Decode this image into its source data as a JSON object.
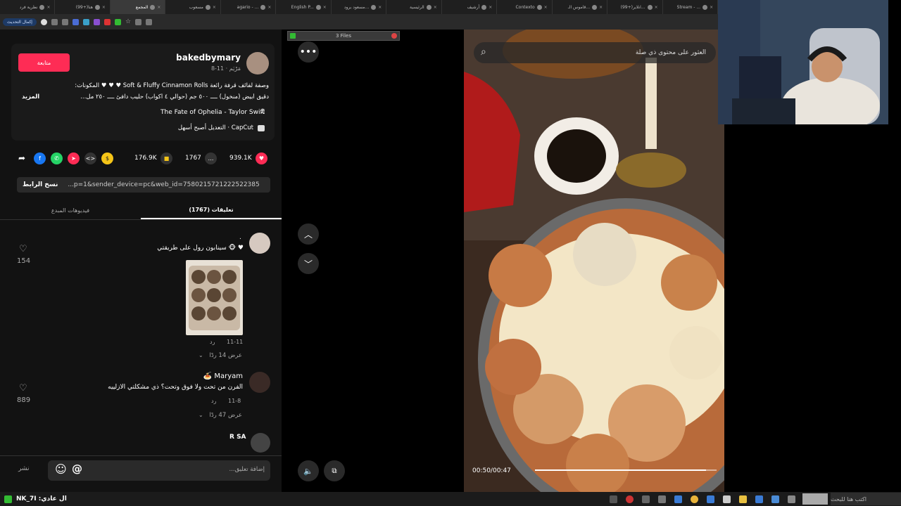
{
  "tabs": [
    "Stream - ...",
    "(99+)انلاير...",
    "قاموس الـ...",
    "Contexto",
    "أرشيف",
    "الرئيسية",
    "مسعود برود...",
    "English P...",
    "agario - ...",
    "مسعوب",
    "المجمع",
    "(99+)هنا",
    "نظرية فرد"
  ],
  "toolbar": {
    "update_label": "إكمال التحديث"
  },
  "download": {
    "label": "3 Files"
  },
  "post": {
    "follow_label": "متابعة",
    "username": "bakedbymary",
    "subtitle": "مَرْيَم · 11-8",
    "desc_line1": "وصفة لفائف قرفة رائعة Soft & Fluffy Cinnamon Rolls ♥ ♥ ♥ المكونات:",
    "desc_line2": "دقيق أبيض (منخول) ــــ ٥٠٠ جم (حوالي ٤ أكواب) حليب دافئ ــــ ٢٥٠ مل...",
    "more": "المزيد",
    "music": "The Fate of Ophelia - Taylor Swift",
    "capcut": "CapCut · التعديل أصبح أسهل",
    "likes": "939.1K",
    "comments": "1767",
    "saves": "176.9K",
    "link": "...p=1&sender_device=pc&web_id=7580215721222522385",
    "copy_link": "نسخ الرابط"
  },
  "tabs_panel": {
    "comments": "تعليقات (1767)",
    "creator_videos": "فيديوهات المبدع"
  },
  "comments": [
    {
      "user": ".",
      "text": "♥ 🐵 سينابون رول على طريقتي",
      "date": "11-11",
      "reply": "رد",
      "view_replies": "عرض 14 ردًا",
      "likes": "154"
    },
    {
      "user": "Maryam 🍝",
      "text": "الفرن من تحت ولا فوق وتحت؟ ذي مشكلتي الازلييه",
      "date": "11-8",
      "reply": "رد",
      "view_replies": "عرض 47 ردًا",
      "likes": "889"
    },
    {
      "user": "R SA",
      "text": ""
    }
  ],
  "comment_bar": {
    "placeholder": "إضافة تعليق...",
    "post": "نشر"
  },
  "video": {
    "search": "العثور على محتوى ذي صلة",
    "time": "00:50/00:47",
    "progress": 0.94
  },
  "taskbar": {
    "user": "NK_7I :ال عادي",
    "search": "اكتب هنا للبحث"
  }
}
